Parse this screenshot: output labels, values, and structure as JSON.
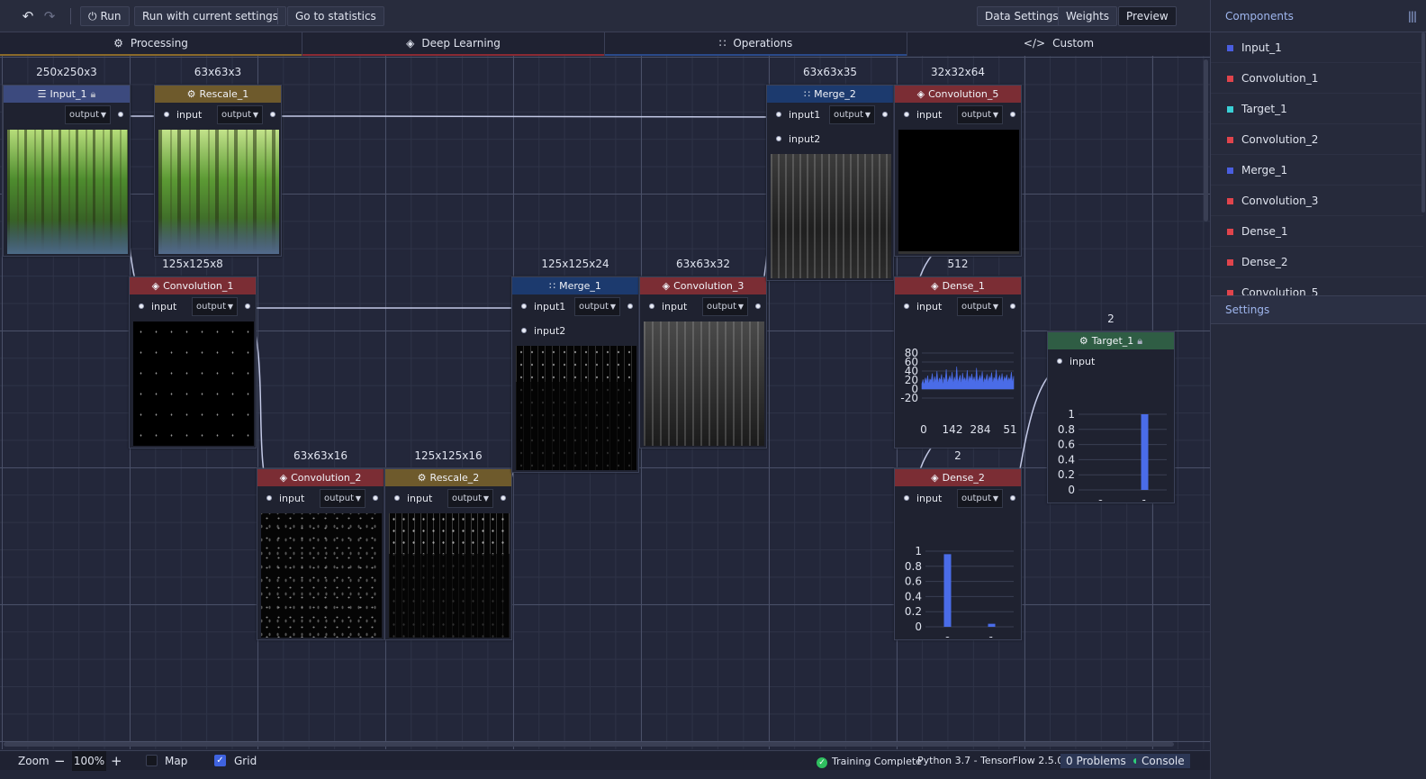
{
  "toolbar": {
    "undo_icon": "undo-icon",
    "redo_icon": "redo-icon",
    "run_label": "Run",
    "run_current_label": "Run with current settings",
    "statistics_label": "Go to statistics",
    "data_settings_label": "Data Settings",
    "weights_label": "Weights",
    "preview_label": "Preview"
  },
  "tabs": [
    {
      "label": "Processing",
      "icon": "gear-icon",
      "accent": "#8a6a2a"
    },
    {
      "label": "Deep Learning",
      "icon": "layers-icon",
      "accent": "#8a2a33"
    },
    {
      "label": "Operations",
      "icon": "grid-icon",
      "accent": "#2a4a8a"
    },
    {
      "label": "Custom",
      "icon": "code-icon",
      "accent": "#1f2232"
    }
  ],
  "colors": {
    "processing": "#6e5a2c",
    "deep_learning": "#7b2d34",
    "operations": "#1c3a6e",
    "input": "#3c4a7e",
    "target": "#2f5d44",
    "wire": "#c3c9e6",
    "bar": "#4a6ce8"
  },
  "nodes": {
    "input_1": {
      "title": "Input_1",
      "shape": "250x250x3",
      "out": "output",
      "icon": "database-icon",
      "lock_icon": "lock-icon"
    },
    "rescale_1": {
      "title": "Rescale_1",
      "shape": "63x63x3",
      "in": "input",
      "out": "output",
      "icon": "gear-icon"
    },
    "convolution_1": {
      "title": "Convolution_1",
      "shape": "125x125x8",
      "in": "input",
      "out": "output",
      "icon": "layers-icon"
    },
    "convolution_2": {
      "title": "Convolution_2",
      "shape": "63x63x16",
      "in": "input",
      "out": "output",
      "icon": "layers-icon"
    },
    "rescale_2": {
      "title": "Rescale_2",
      "shape": "125x125x16",
      "in": "input",
      "out": "output",
      "icon": "gear-icon"
    },
    "merge_1": {
      "title": "Merge_1",
      "shape": "125x125x24",
      "in1": "input1",
      "in2": "input2",
      "out": "output",
      "icon": "grid-icon"
    },
    "convolution_3": {
      "title": "Convolution_3",
      "shape": "63x63x32",
      "in": "input",
      "out": "output",
      "icon": "layers-icon"
    },
    "merge_2": {
      "title": "Merge_2",
      "shape": "63x63x35",
      "in1": "input1",
      "in2": "input2",
      "out": "output",
      "icon": "grid-icon"
    },
    "convolution_5": {
      "title": "Convolution_5",
      "shape": "32x32x64",
      "in": "input",
      "out": "output",
      "icon": "layers-icon"
    },
    "dense_1": {
      "title": "Dense_1",
      "shape": "512",
      "in": "input",
      "out": "output",
      "icon": "layers-icon"
    },
    "dense_2": {
      "title": "Dense_2",
      "shape": "2",
      "in": "input",
      "out": "output",
      "icon": "layers-icon"
    },
    "target_1": {
      "title": "Target_1",
      "shape": "2",
      "in": "input",
      "icon": "gear-icon",
      "lock_icon": "lock-icon"
    }
  },
  "chart_data": [
    {
      "id": "dense_1_preview",
      "type": "area",
      "yticks": [
        "80",
        "60",
        "40",
        "20",
        "0",
        "-20"
      ],
      "xticks": [
        "0",
        "142",
        "284",
        "51"
      ],
      "ylim": [
        -20,
        80
      ],
      "xlim": [
        0,
        512
      ],
      "values": [
        12,
        20,
        8,
        25,
        15,
        30,
        10,
        22,
        18,
        35,
        9,
        28,
        14,
        40,
        11,
        24,
        19,
        33,
        7,
        26,
        16,
        44,
        12,
        21,
        29,
        17,
        38,
        10,
        27,
        15,
        50,
        13,
        23,
        31,
        9,
        36,
        18,
        25,
        14,
        42,
        11,
        29,
        20,
        34,
        16,
        27,
        12,
        47,
        15,
        22,
        30,
        18,
        39,
        10,
        24,
        17,
        33,
        13,
        28,
        21,
        37,
        11,
        26,
        19,
        43,
        14,
        23,
        30,
        16,
        35,
        12,
        27,
        20,
        32,
        15,
        25,
        18,
        38,
        13,
        29
      ],
      "grid": true
    },
    {
      "id": "dense_2_preview",
      "type": "bar",
      "categories": [
        "0",
        "1"
      ],
      "values": [
        0.96,
        0.04
      ],
      "yticks": [
        "1",
        "0.8",
        "0.6",
        "0.4",
        "0.2",
        "0"
      ],
      "ylim": [
        0,
        1
      ],
      "grid": true
    },
    {
      "id": "target_1_preview",
      "type": "bar",
      "categories": [
        "0",
        "1"
      ],
      "values": [
        0,
        1
      ],
      "yticks": [
        "1",
        "0.8",
        "0.6",
        "0.4",
        "0.2",
        "0"
      ],
      "ylim": [
        0,
        1
      ],
      "grid": true
    }
  ],
  "sidebar": {
    "components_title": "Components",
    "panel_icon": "panel-icon",
    "items": [
      {
        "label": "Input_1",
        "color": "#4a5ee0"
      },
      {
        "label": "Convolution_1",
        "color": "#e0444c"
      },
      {
        "label": "Target_1",
        "color": "#3ad0d6"
      },
      {
        "label": "Convolution_2",
        "color": "#e0444c"
      },
      {
        "label": "Merge_1",
        "color": "#4a5ee0"
      },
      {
        "label": "Convolution_3",
        "color": "#e0444c"
      },
      {
        "label": "Dense_1",
        "color": "#e0444c"
      },
      {
        "label": "Dense_2",
        "color": "#e0444c"
      },
      {
        "label": "Convolution_5",
        "color": "#e0444c"
      }
    ],
    "settings_title": "Settings"
  },
  "statusbar": {
    "zoom_label": "Zoom",
    "zoom_value": "100",
    "zoom_unit": "%",
    "map_label": "Map",
    "map_checked": false,
    "grid_label": "Grid",
    "grid_checked": true,
    "training_status": "Training Complete",
    "env": "Python 3.7 - TensorFlow 2.5.0",
    "problems": "0 Problems",
    "console_label": "Console"
  }
}
